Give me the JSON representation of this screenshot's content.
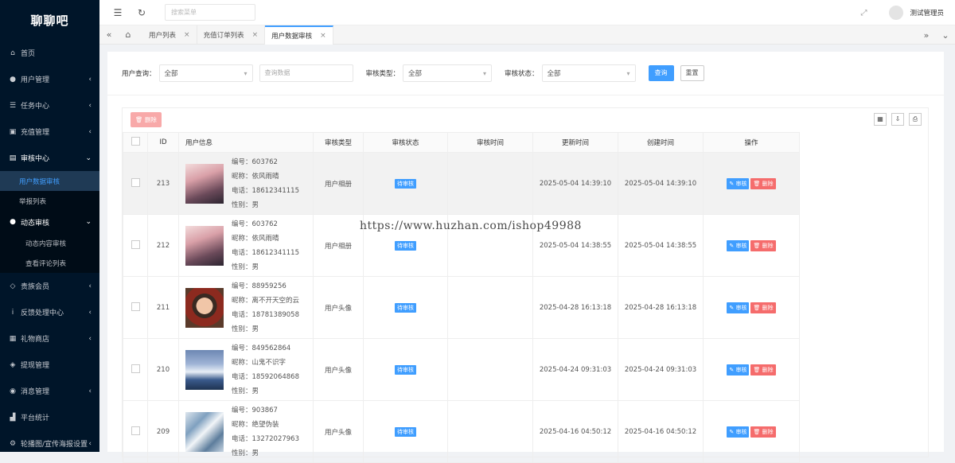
{
  "app": {
    "title": "聊聊吧"
  },
  "sidebar": {
    "items": [
      {
        "label": "首页",
        "icon": "home-icon",
        "glyph": "⌂"
      },
      {
        "label": "用户管理",
        "icon": "user-icon",
        "glyph": "●",
        "chevron": "‹"
      },
      {
        "label": "任务中心",
        "icon": "list-icon",
        "glyph": "☰",
        "chevron": "‹"
      },
      {
        "label": "充值管理",
        "icon": "wallet-icon",
        "glyph": "▣",
        "chevron": "‹"
      },
      {
        "label": "审核中心",
        "icon": "book-icon",
        "glyph": "▤",
        "chevron": "⌄"
      }
    ],
    "audit_sub": {
      "item1": "用户数据审核",
      "item2": "举报列表",
      "dynamic": {
        "label": "动态审核",
        "chevron": "⌄"
      },
      "dyn1": "动态内容审核",
      "dyn2": "查看评论列表"
    },
    "items_after": [
      {
        "label": "贵族会员",
        "icon": "diamond-icon",
        "glyph": "◇",
        "chevron": "‹"
      },
      {
        "label": "反馈处理中心",
        "icon": "info-icon",
        "glyph": "i",
        "chevron": "‹"
      },
      {
        "label": "礼物商店",
        "icon": "gift-icon",
        "glyph": "▦",
        "chevron": "‹"
      },
      {
        "label": "提现管理",
        "icon": "bag-icon",
        "glyph": "◈"
      },
      {
        "label": "消息管理",
        "icon": "chat-icon",
        "glyph": "◉",
        "chevron": "‹"
      },
      {
        "label": "平台统计",
        "icon": "chart-icon",
        "glyph": "▟"
      },
      {
        "label": "轮播图/宣传海报设置",
        "icon": "gear-icon",
        "glyph": "⚙",
        "chevron": "‹"
      }
    ]
  },
  "topbar": {
    "menu_icon": "☰",
    "refresh_icon": "↻",
    "search_placeholder": "搜索菜单",
    "fullscreen_icon": "⤢",
    "username": "测试管理员"
  },
  "tabs": {
    "prev": "«",
    "home": "⌂",
    "items": [
      {
        "label": "用户列表",
        "close": "×"
      },
      {
        "label": "充值订单列表",
        "close": "×"
      },
      {
        "label": "用户数据审核",
        "close": "×"
      }
    ],
    "next": "»",
    "more": "⌄"
  },
  "filters": {
    "user_query_label": "用户查询：",
    "user_query_value": "全部",
    "query_placeholder": "查询数据",
    "review_type_label": "审核类型：",
    "review_type_value": "全部",
    "review_status_label": "审核状态：",
    "review_status_value": "全部",
    "caret": "▾",
    "query_btn": "查询",
    "reset_btn": "重置"
  },
  "toolbar": {
    "bulk_delete": "🗑 删除",
    "icons": [
      "▦",
      "⇩",
      "⎙"
    ]
  },
  "table": {
    "headers": {
      "id": "ID",
      "userinfo": "用户信息",
      "type": "审核类型",
      "status": "审核状态",
      "review_time": "审核时间",
      "updated": "更新时间",
      "created": "创建时间",
      "actions": "操作"
    },
    "rows": [
      {
        "id": "213",
        "no": "编号：603762",
        "nick": "昵称：依风雨晴",
        "phone": "电话：18612341115",
        "gender": "性别：男",
        "type": "用户相册",
        "status": "待审核",
        "review_time": "",
        "updated": "2025-05-04 14:39:10",
        "created": "2025-05-04 14:39:10",
        "edit": "✎ 审核",
        "del": "🗑 删除"
      },
      {
        "id": "212",
        "no": "编号：603762",
        "nick": "昵称：依风雨晴",
        "phone": "电话：18612341115",
        "gender": "性别：男",
        "type": "用户相册",
        "status": "待审核",
        "review_time": "",
        "updated": "2025-05-04 14:38:55",
        "created": "2025-05-04 14:38:55",
        "edit": "✎ 审核",
        "del": "🗑 删除"
      },
      {
        "id": "211",
        "no": "编号：88959256",
        "nick": "昵称：离不开天空的云",
        "phone": "电话：18781389058",
        "gender": "性别：男",
        "type": "用户头像",
        "status": "待审核",
        "review_time": "",
        "updated": "2025-04-28 16:13:18",
        "created": "2025-04-28 16:13:18",
        "edit": "✎ 审核",
        "del": "🗑 删除"
      },
      {
        "id": "210",
        "no": "编号：849562864",
        "nick": "昵称：山鬼不识字",
        "phone": "电话：18592064868",
        "gender": "性别：男",
        "type": "用户头像",
        "status": "待审核",
        "review_time": "",
        "updated": "2025-04-24 09:31:03",
        "created": "2025-04-24 09:31:03",
        "edit": "✎ 审核",
        "del": "🗑 删除"
      },
      {
        "id": "209",
        "no": "编号：903867",
        "nick": "昵称：绝望伪装",
        "phone": "电话：13272027963",
        "gender": "性别：男",
        "type": "用户头像",
        "status": "待审核",
        "review_time": "",
        "updated": "2025-04-16 04:50:12",
        "created": "2025-04-16 04:50:12",
        "edit": "✎ 审核",
        "del": "🗑 删除"
      }
    ]
  },
  "watermark": "https://www.huzhan.com/ishop49988",
  "colors": {
    "primary": "#409eff",
    "danger": "#f56c6c",
    "sidebar": "#001529"
  }
}
